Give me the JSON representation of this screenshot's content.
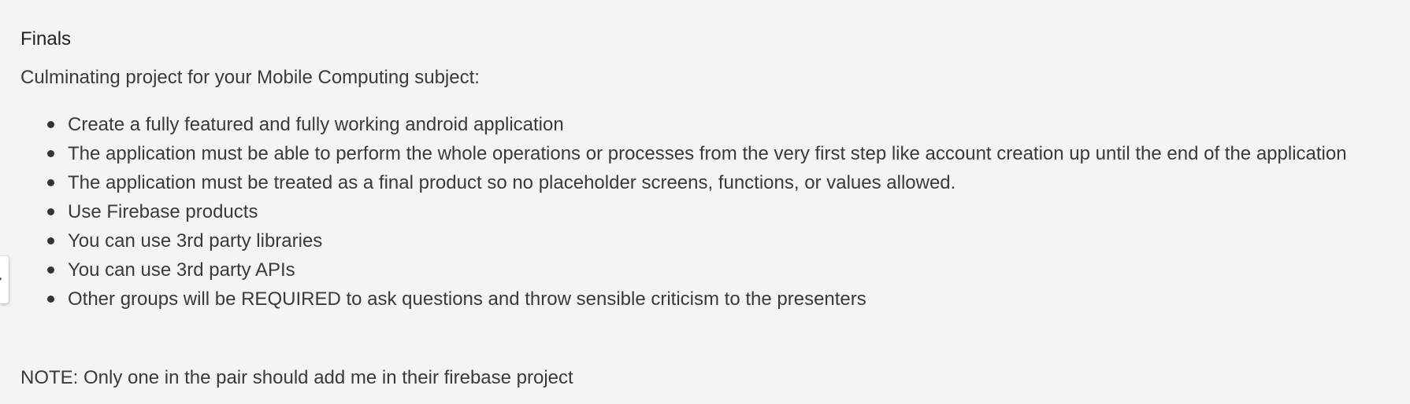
{
  "heading": "Finals",
  "intro": "Culminating project for your Mobile Computing subject:",
  "requirements": [
    "Create a fully featured and fully working android application",
    "The application must be able to perform the whole operations or processes from the very first step like account creation up until the end of the application",
    "The application must be treated as a final product so no placeholder screens, functions, or values allowed.",
    "Use Firebase products",
    "You can use 3rd party libraries",
    "You can use 3rd party APIs",
    "Other groups will be REQUIRED to ask questions and throw sensible criticism to the presenters"
  ],
  "note": "NOTE: Only one in the pair should add me in their firebase project",
  "side_toggle_icon": "chevron-right-icon"
}
